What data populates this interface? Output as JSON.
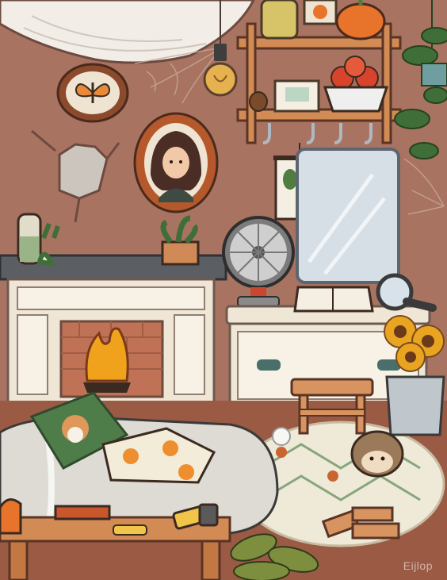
{
  "scene": {
    "colors": {
      "wall": "#a87361",
      "floor": "#9a5a43",
      "fireplace": "#efe6d6",
      "mantel": "#5b5f63",
      "fire": "#f0a21c",
      "pumpkin": "#e8732b",
      "plant": "#4f7d3f",
      "rug": "#efe9d8"
    },
    "icons": [
      "butterfly-icon",
      "pumpkin-icon",
      "fan-icon",
      "magnifier-icon",
      "hedgehog-icon",
      "sunflower-icon",
      "corgi-pillow-icon"
    ]
  },
  "watermark": {
    "text": "Eijlop"
  }
}
